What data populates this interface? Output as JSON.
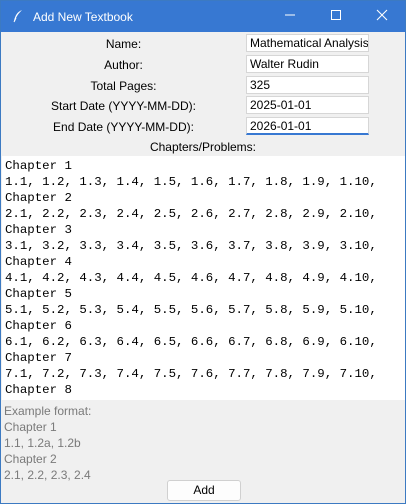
{
  "window": {
    "title": "Add New Textbook"
  },
  "form": {
    "name_label": "Name:",
    "name_value": "Mathematical Analysis",
    "author_label": "Author:",
    "author_value": "Walter Rudin",
    "pages_label": "Total Pages:",
    "pages_value": "325",
    "start_label": "Start Date (YYYY-MM-DD):",
    "start_value": "2025-01-01",
    "end_label": "End Date (YYYY-MM-DD):",
    "end_value": "2026-01-01",
    "chapters_label": "Chapters/Problems:"
  },
  "chapters_text": [
    "Chapter 1",
    "1.1, 1.2, 1.3, 1.4, 1.5, 1.6, 1.7, 1.8, 1.9, 1.10,",
    "Chapter 2",
    "2.1, 2.2, 2.3, 2.4, 2.5, 2.6, 2.7, 2.8, 2.9, 2.10,",
    "Chapter 3",
    "3.1, 3.2, 3.3, 3.4, 3.5, 3.6, 3.7, 3.8, 3.9, 3.10,",
    "Chapter 4",
    "4.1, 4.2, 4.3, 4.4, 4.5, 4.6, 4.7, 4.8, 4.9, 4.10,",
    "Chapter 5",
    "5.1, 5.2, 5.3, 5.4, 5.5, 5.6, 5.7, 5.8, 5.9, 5.10,",
    "Chapter 6",
    "6.1, 6.2, 6.3, 6.4, 6.5, 6.6, 6.7, 6.8, 6.9, 6.10,",
    "Chapter 7",
    "7.1, 7.2, 7.3, 7.4, 7.5, 7.6, 7.7, 7.8, 7.9, 7.10,",
    "Chapter 8"
  ],
  "example": [
    "Example format:",
    "Chapter 1",
    "1.1, 1.2a, 1.2b",
    "Chapter 2",
    "2.1, 2.2, 2.3, 2.4"
  ],
  "buttons": {
    "add_label": "Add"
  },
  "icons": {
    "app": "feather-icon",
    "minimize": "minimize-icon",
    "maximize": "maximize-icon",
    "close": "close-icon"
  },
  "colors": {
    "titlebar": "#3778d2",
    "window_bg": "#f0f0f0"
  }
}
